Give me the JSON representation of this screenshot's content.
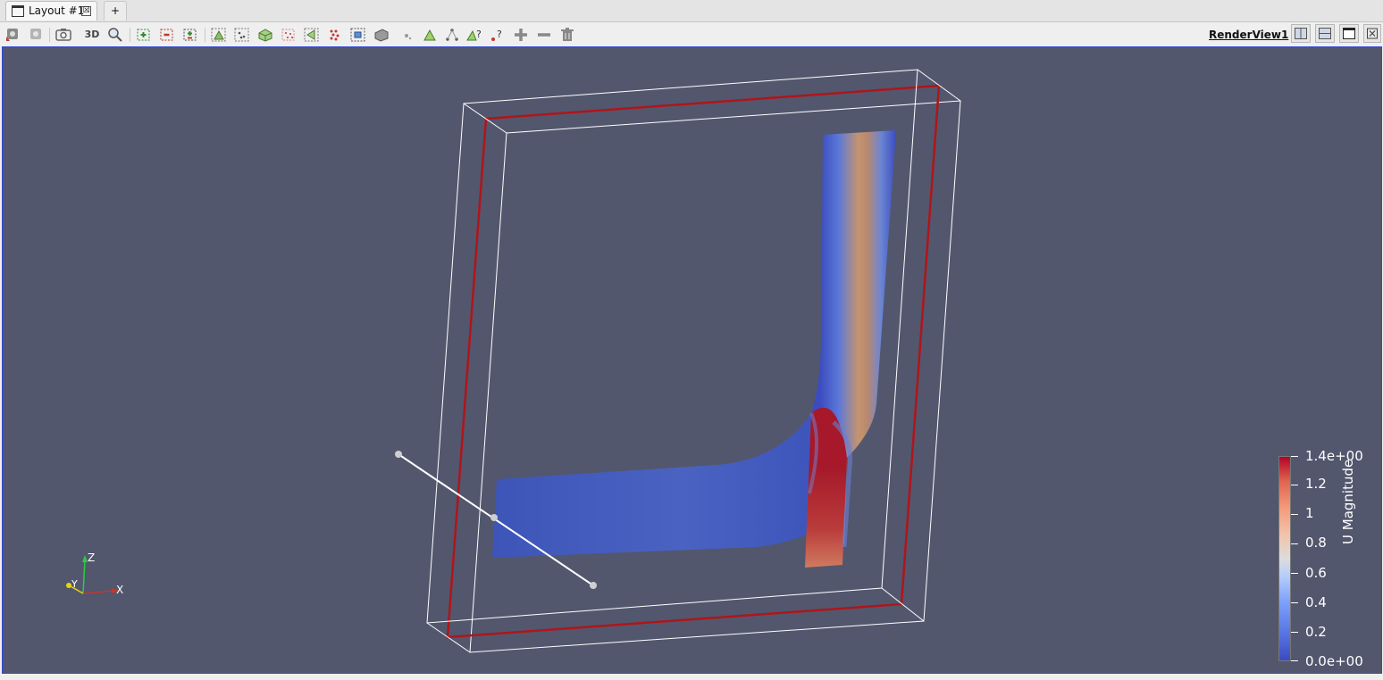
{
  "tabs": [
    {
      "label": "Layout #1",
      "close": "☒"
    }
  ],
  "add_tab_label": "+",
  "toolbar": {
    "three_d_label": "3D",
    "buttons": [
      "reset-camera-icon",
      "reset-camera-closest-icon",
      "capture-screenshot-icon",
      "3d-toggle",
      "zoom-to-data-icon",
      "zoom-to-box-icon",
      "zoom-out-box-icon",
      "zoom-closest-icon",
      "select-surface-cells-icon",
      "select-surface-points-icon",
      "select-frustum-cells-icon",
      "select-frustum-points-icon",
      "select-polygon-cells-icon",
      "select-polygon-points-icon",
      "select-block-icon",
      "interactive-select-icon",
      "hover-points-icon",
      "hover-cells-icon",
      "grow-selection-icon",
      "shrink-selection-icon",
      "clear-selection-icon"
    ]
  },
  "render_view": {
    "title": "RenderView1",
    "controls": [
      "split-horizontal-icon",
      "split-vertical-icon",
      "maximize-icon",
      "close-icon"
    ]
  },
  "colors": {
    "background": "#52576e",
    "outline": "#ffffff",
    "highlight_box": "#b0151a",
    "cold": "#3b4cc0",
    "hot": "#b40426"
  },
  "axes_widget": {
    "x": "X",
    "y": "Y",
    "z": "Z"
  },
  "color_legend": {
    "title": "U Magnitude",
    "range": [
      0.0,
      1.4
    ],
    "labels": [
      "1.4e+00",
      "1.2",
      "1",
      "0.8",
      "0.6",
      "0.4",
      "0.2",
      "0.0e+00"
    ]
  }
}
